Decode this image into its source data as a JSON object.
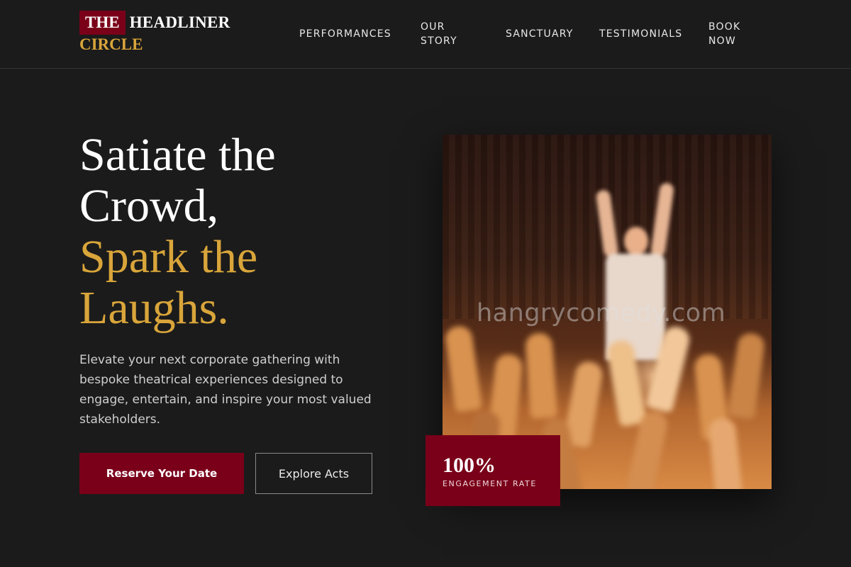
{
  "brand": {
    "the": "THE",
    "headliner": "HEADLINER",
    "circle": "CIRCLE"
  },
  "nav": {
    "items": [
      {
        "label": "PERFORMANCES"
      },
      {
        "label": "OUR STORY"
      },
      {
        "label": "SANCTUARY"
      },
      {
        "label": "TESTIMONIALS"
      },
      {
        "label": "BOOK NOW"
      }
    ]
  },
  "hero": {
    "title_white_1": "Satiate the",
    "title_white_2": "Crowd,",
    "title_gold_1": "Spark the",
    "title_gold_2": "Laughs.",
    "description": "Elevate your next corporate gathering with bespoke theatrical experiences designed to engage, entertain, and inspire your most valued stakeholders.",
    "primary_cta": "Reserve Your Date",
    "secondary_cta": "Explore Acts"
  },
  "image": {
    "watermark": "hangrycomedy.com"
  },
  "stat": {
    "value": "100%",
    "label": "ENGAGEMENT RATE"
  },
  "colors": {
    "background": "#1b1b1b",
    "accent_red": "#7a0019",
    "accent_gold": "#d9a53a"
  }
}
